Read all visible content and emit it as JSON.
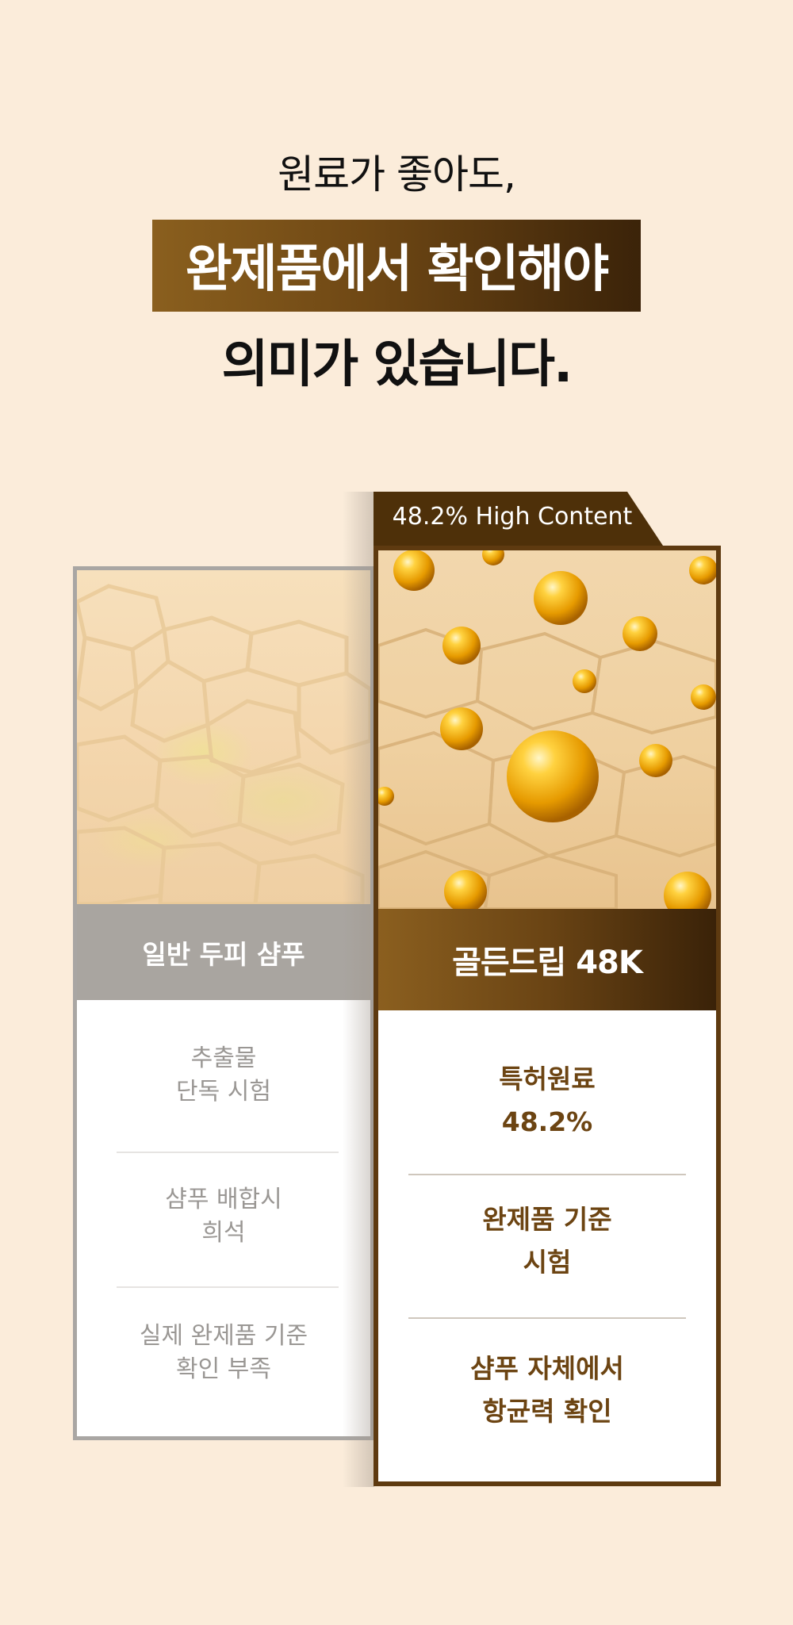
{
  "headline": {
    "line1": "원료가 좋아도,",
    "line2": "완제품에서 확인해야",
    "line3": "의미가 있습니다."
  },
  "comparison": {
    "badge": "48.2% High Content",
    "left": {
      "title": "일반 두피 샴푸",
      "rows": [
        [
          "추출물",
          "단독 시험"
        ],
        [
          "샴푸 배합시",
          "희석"
        ],
        [
          "실제 완제품 기준",
          "확인 부족"
        ]
      ]
    },
    "right": {
      "title": "골든드립 48K",
      "rows": [
        [
          "특허원료",
          "48.2%"
        ],
        [
          "완제품 기준",
          "시험"
        ],
        [
          "샴푸 자체에서",
          "항균력 확인"
        ]
      ]
    }
  },
  "colors": {
    "background": "#fbecda",
    "accent_brown": "#6e4714",
    "left_gray": "#a9a5a0",
    "right_text": "#6c4412"
  }
}
